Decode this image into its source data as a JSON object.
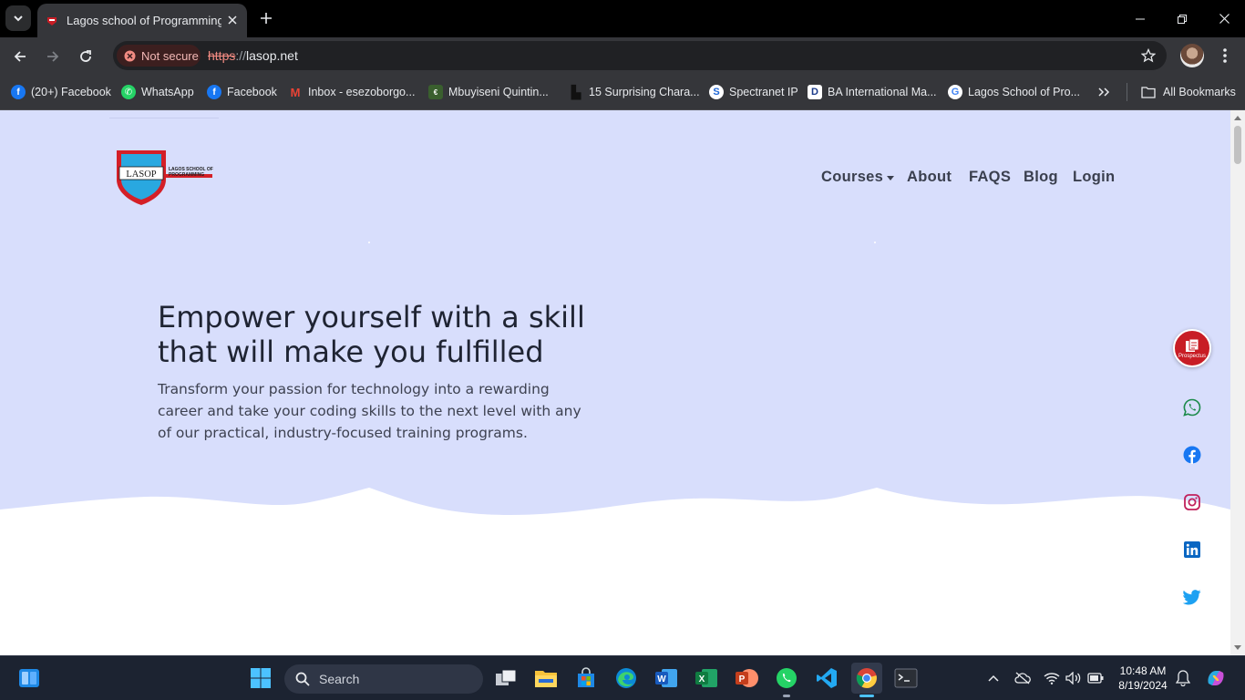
{
  "browser": {
    "tab_title": "Lagos school of Programming |",
    "security_label": "Not secure",
    "url_scheme": "https",
    "url_sep": "://",
    "url_host": "lasop.net"
  },
  "bookmarks": [
    {
      "label": "(20+) Facebook",
      "icon": "facebook-icon",
      "color": "#1877f2"
    },
    {
      "label": "WhatsApp",
      "icon": "whatsapp-icon",
      "color": "#25d366"
    },
    {
      "label": "Facebook",
      "icon": "facebook-icon",
      "color": "#1877f2"
    },
    {
      "label": "Inbox - esezoborgo...",
      "icon": "gmail-icon",
      "color": "#ea4335"
    },
    {
      "label": "Mbuyiseni Quintin...",
      "icon": "epa-icon",
      "color": "#2e7d32"
    },
    {
      "label": "15 Surprising Chara...",
      "icon": "site-icon",
      "color": "#111111"
    },
    {
      "label": "Spectranet IP",
      "icon": "spectranet-icon",
      "color": "#1e66d6"
    },
    {
      "label": "BA International Ma...",
      "icon": "d-icon",
      "color": "#ffffff"
    },
    {
      "label": "Lagos School of Pro...",
      "icon": "google-icon",
      "color": "#4285f4"
    }
  ],
  "all_bookmarks_label": "All Bookmarks",
  "site": {
    "logo_text": "LASOP",
    "logo_subtext_1": "LAGOS SCHOOL OF",
    "logo_subtext_2": "PROGRAMMING",
    "nav": {
      "courses": "Courses",
      "about": "About",
      "faqs": "FAQS",
      "blog": "Blog",
      "login": "Login"
    },
    "headline": "Empower yourself with a skill that will make you fulfilled",
    "subtext": "Transform your passion for technology into a rewarding career and take your coding skills to the next level with any of our practical, industry-focused training programs.",
    "prospectus_label": "Prospectus"
  },
  "taskbar": {
    "search_placeholder": "Search",
    "time": "10:48 AM",
    "date": "8/19/2024"
  }
}
